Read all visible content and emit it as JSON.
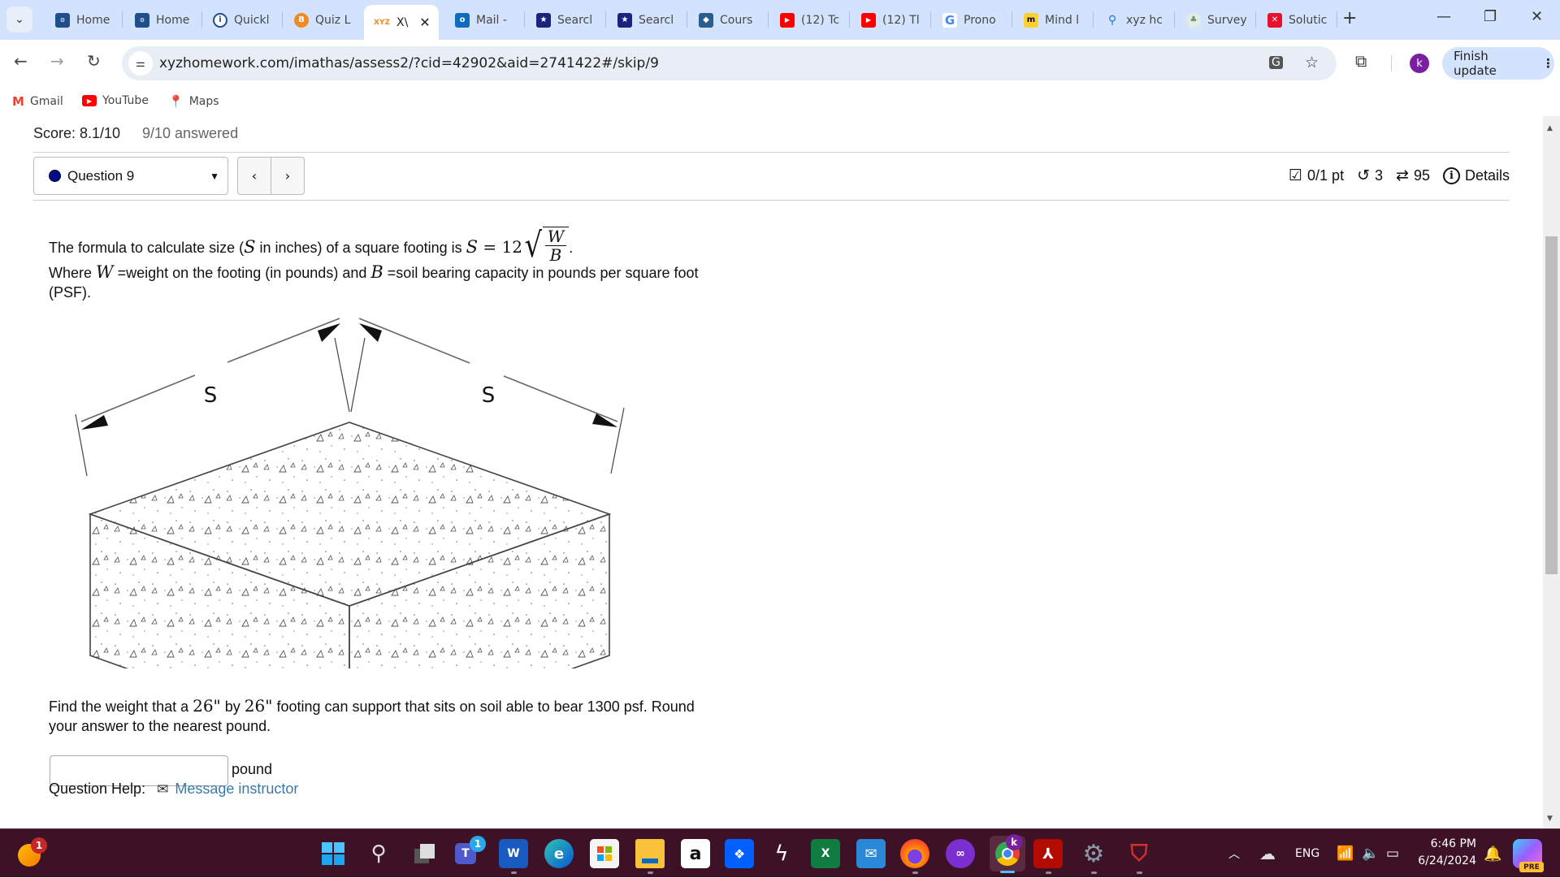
{
  "browser": {
    "tabs": [
      {
        "label": "Home",
        "favicon": "ccbc-icon",
        "color": "#1f4e8c"
      },
      {
        "label": "Home",
        "favicon": "ccbc-icon",
        "color": "#1f4e8c"
      },
      {
        "label": "Quickl",
        "favicon": "quick-icon",
        "color": "#1f4e8c"
      },
      {
        "label": "Quiz L",
        "favicon": "b-icon",
        "color": "#f08a24"
      },
      {
        "label": "X\\",
        "favicon": "xyz-icon",
        "color": "#f08a24",
        "active": true
      },
      {
        "label": "Mail -",
        "favicon": "outlook-icon",
        "color": "#0f6cbd"
      },
      {
        "label": "Searcl",
        "favicon": "star-shield-icon",
        "color": "#1a237e"
      },
      {
        "label": "Searcl",
        "favicon": "star-shield-icon",
        "color": "#1a237e"
      },
      {
        "label": "Cours",
        "favicon": "course-hero-icon",
        "color": "#2c5d8f"
      },
      {
        "label": "(12) Tc",
        "favicon": "youtube-icon",
        "color": "#ff0000"
      },
      {
        "label": "(12) Tl",
        "favicon": "youtube-icon",
        "color": "#ff0000"
      },
      {
        "label": "Prono",
        "favicon": "google-icon",
        "color": "#4285f4"
      },
      {
        "label": "Mind l",
        "favicon": "miro-icon",
        "color": "#ffd02f"
      },
      {
        "label": "xyz hc",
        "favicon": "search-icon",
        "color": "#1a73e8"
      },
      {
        "label": "Survey",
        "favicon": "tree-icon",
        "color": "#6b8f71"
      },
      {
        "label": "Solutic",
        "favicon": "x-icon",
        "color": "#e8112d"
      }
    ],
    "xyz_tag": "XYZ",
    "new_tab": "+",
    "window_controls": {
      "minimize": "—",
      "restore": "❐",
      "close": "✕"
    },
    "url": "xyzhomework.com/imathas/assess2/?cid=42902&aid=2741422#/skip/9",
    "profile_initial": "k",
    "finish_update": "Finish update",
    "bookmarks": [
      {
        "label": "Gmail",
        "icon": "gmail-icon"
      },
      {
        "label": "YouTube",
        "icon": "youtube-icon"
      },
      {
        "label": "Maps",
        "icon": "maps-icon"
      }
    ]
  },
  "assessment": {
    "score": "Score: 8.1/10",
    "answered": "9/10 answered",
    "question_select": "Question 9",
    "prev": "‹",
    "next": "›",
    "points": "0/1 pt",
    "retries": "3",
    "versions": "95",
    "details": "Details"
  },
  "question": {
    "intro_1": "The formula to calculate size (",
    "var_S": "S",
    "intro_2": " in inches) of a square footing is ",
    "eq_lhs": "S",
    "eq_sign": " = 12",
    "frac_num": "W",
    "frac_den": "B",
    "period": ".",
    "where": "Where ",
    "var_W": "W",
    "w_def": " =weight on the footing (in pounds) and ",
    "var_B": "B",
    "b_def": " =soil bearing capacity in pounds per square foot",
    "psf": "(PSF).",
    "figure_label_left": "S",
    "figure_label_right": "S",
    "prompt_1": "Find the weight that a ",
    "dim_1": "26\"",
    "prompt_by": " by ",
    "dim_2": "26\"",
    "prompt_2": " footing can support that sits on soil able to bear 1300 psf. Round",
    "prompt_3": "your answer to the nearest pound.",
    "answer_value": "",
    "unit": "pound",
    "help_label": "Question Help:",
    "message_link": "Message instructor"
  },
  "taskbar": {
    "notification_count": "1",
    "teams_badge": "1",
    "chrome_badge": "k",
    "language": "ENG",
    "time": "6:46 PM",
    "date": "6/24/2024",
    "copilot_tag": "PRE"
  }
}
